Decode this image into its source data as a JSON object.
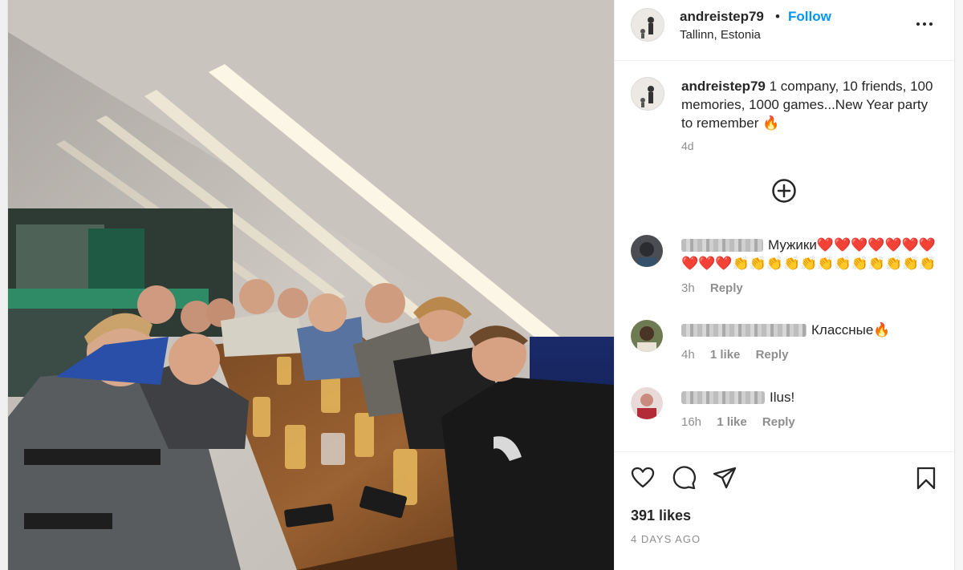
{
  "post": {
    "username": "andreistep79",
    "separator": "•",
    "follow_label": "Follow",
    "location": "Tallinn, Estonia",
    "caption_user": "andreistep79",
    "caption_text": "1 company, 10 friends, 100 memories, 1000 games...New Year party to remember 🔥",
    "caption_time": "4d",
    "likes": "391 likes",
    "date": "4 DAYS AGO"
  },
  "comments": [
    {
      "text": "Мужики❤️❤️❤️❤️❤️❤️❤️❤️❤️❤️👏👏👏👏👏👏👏👏👏👏👏👏",
      "time": "3h",
      "likes": "",
      "reply": "Reply"
    },
    {
      "text": "Классные🔥",
      "time": "4h",
      "likes": "1 like",
      "reply": "Reply"
    },
    {
      "text": "Ilus!",
      "time": "16h",
      "likes": "1 like",
      "reply": "Reply"
    }
  ],
  "icons": {
    "more": "more-options-icon",
    "load_more": "plus-circle-icon",
    "like": "heart-icon",
    "comment": "comment-icon",
    "share": "send-icon",
    "save": "bookmark-icon"
  },
  "colors": {
    "follow": "#0095f6",
    "text": "#262626",
    "secondary": "#8e8e8e"
  }
}
